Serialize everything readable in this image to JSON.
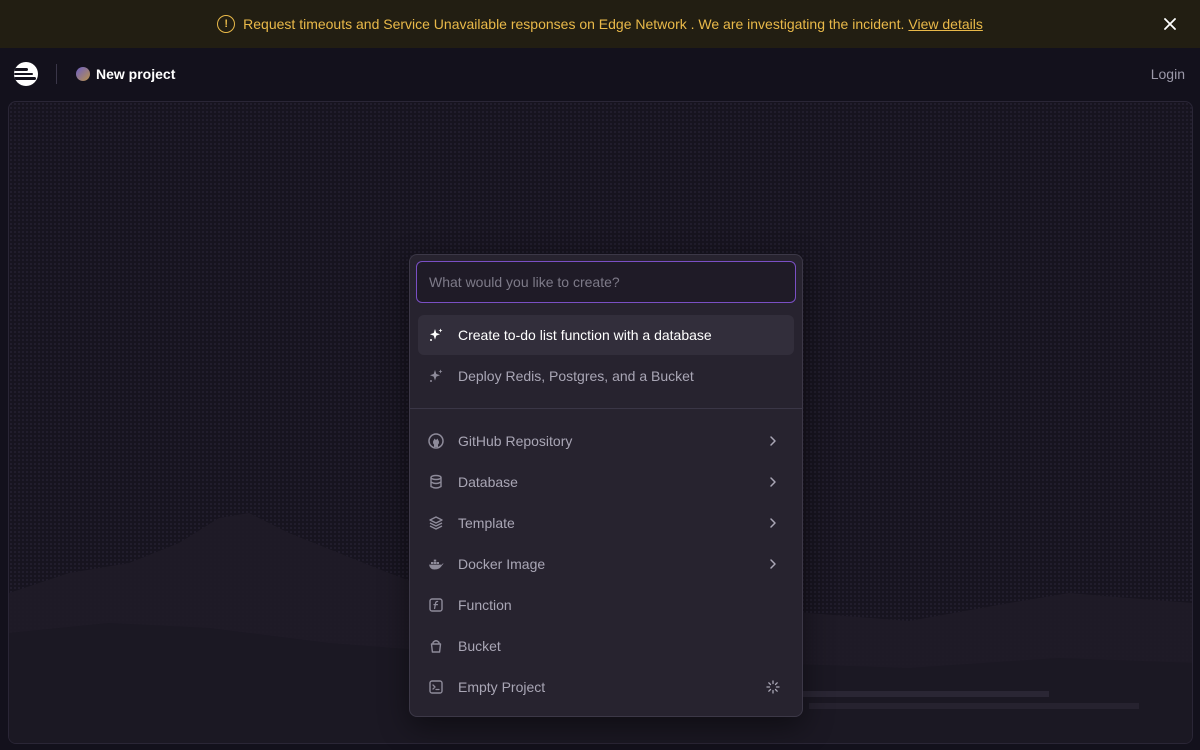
{
  "banner": {
    "message": "Request timeouts and Service Unavailable responses on Edge Network . We are investigating the incident.",
    "link": "View details",
    "color": "#e9b949"
  },
  "header": {
    "project_name": "New project",
    "login": "Login"
  },
  "palette": {
    "placeholder": "What would you like to create?",
    "accent": "#7a4fc4",
    "suggestions": [
      {
        "label": "Create to-do list function with a database",
        "icon": "sparkle-icon"
      },
      {
        "label": "Deploy Redis, Postgres, and a Bucket",
        "icon": "sparkle-icon"
      }
    ],
    "options": [
      {
        "label": "GitHub Repository",
        "icon": "github-icon",
        "has_submenu": true
      },
      {
        "label": "Database",
        "icon": "database-icon",
        "has_submenu": true
      },
      {
        "label": "Template",
        "icon": "layers-icon",
        "has_submenu": true
      },
      {
        "label": "Docker Image",
        "icon": "docker-icon",
        "has_submenu": true
      },
      {
        "label": "Function",
        "icon": "function-icon",
        "has_submenu": false
      },
      {
        "label": "Bucket",
        "icon": "bucket-icon",
        "has_submenu": false
      },
      {
        "label": "Empty Project",
        "icon": "terminal-icon",
        "has_submenu": false,
        "loading": true
      }
    ]
  }
}
